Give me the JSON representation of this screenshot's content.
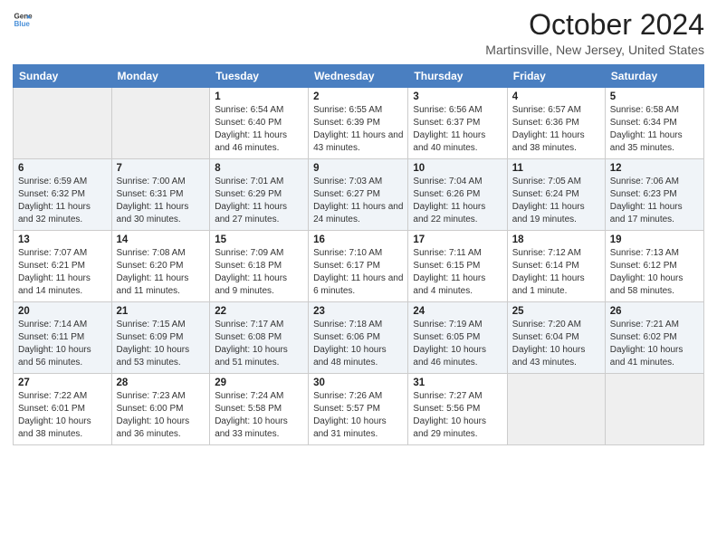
{
  "header": {
    "logo_line1": "General",
    "logo_line2": "Blue",
    "title": "October 2024",
    "subtitle": "Martinsville, New Jersey, United States"
  },
  "weekdays": [
    "Sunday",
    "Monday",
    "Tuesday",
    "Wednesday",
    "Thursday",
    "Friday",
    "Saturday"
  ],
  "weeks": [
    [
      {
        "day": "",
        "empty": true
      },
      {
        "day": "",
        "empty": true
      },
      {
        "day": "1",
        "sunrise": "6:54 AM",
        "sunset": "6:40 PM",
        "daylight": "11 hours and 46 minutes."
      },
      {
        "day": "2",
        "sunrise": "6:55 AM",
        "sunset": "6:39 PM",
        "daylight": "11 hours and 43 minutes."
      },
      {
        "day": "3",
        "sunrise": "6:56 AM",
        "sunset": "6:37 PM",
        "daylight": "11 hours and 40 minutes."
      },
      {
        "day": "4",
        "sunrise": "6:57 AM",
        "sunset": "6:36 PM",
        "daylight": "11 hours and 38 minutes."
      },
      {
        "day": "5",
        "sunrise": "6:58 AM",
        "sunset": "6:34 PM",
        "daylight": "11 hours and 35 minutes."
      }
    ],
    [
      {
        "day": "6",
        "sunrise": "6:59 AM",
        "sunset": "6:32 PM",
        "daylight": "11 hours and 32 minutes."
      },
      {
        "day": "7",
        "sunrise": "7:00 AM",
        "sunset": "6:31 PM",
        "daylight": "11 hours and 30 minutes."
      },
      {
        "day": "8",
        "sunrise": "7:01 AM",
        "sunset": "6:29 PM",
        "daylight": "11 hours and 27 minutes."
      },
      {
        "day": "9",
        "sunrise": "7:03 AM",
        "sunset": "6:27 PM",
        "daylight": "11 hours and 24 minutes."
      },
      {
        "day": "10",
        "sunrise": "7:04 AM",
        "sunset": "6:26 PM",
        "daylight": "11 hours and 22 minutes."
      },
      {
        "day": "11",
        "sunrise": "7:05 AM",
        "sunset": "6:24 PM",
        "daylight": "11 hours and 19 minutes."
      },
      {
        "day": "12",
        "sunrise": "7:06 AM",
        "sunset": "6:23 PM",
        "daylight": "11 hours and 17 minutes."
      }
    ],
    [
      {
        "day": "13",
        "sunrise": "7:07 AM",
        "sunset": "6:21 PM",
        "daylight": "11 hours and 14 minutes."
      },
      {
        "day": "14",
        "sunrise": "7:08 AM",
        "sunset": "6:20 PM",
        "daylight": "11 hours and 11 minutes."
      },
      {
        "day": "15",
        "sunrise": "7:09 AM",
        "sunset": "6:18 PM",
        "daylight": "11 hours and 9 minutes."
      },
      {
        "day": "16",
        "sunrise": "7:10 AM",
        "sunset": "6:17 PM",
        "daylight": "11 hours and 6 minutes."
      },
      {
        "day": "17",
        "sunrise": "7:11 AM",
        "sunset": "6:15 PM",
        "daylight": "11 hours and 4 minutes."
      },
      {
        "day": "18",
        "sunrise": "7:12 AM",
        "sunset": "6:14 PM",
        "daylight": "11 hours and 1 minute."
      },
      {
        "day": "19",
        "sunrise": "7:13 AM",
        "sunset": "6:12 PM",
        "daylight": "10 hours and 58 minutes."
      }
    ],
    [
      {
        "day": "20",
        "sunrise": "7:14 AM",
        "sunset": "6:11 PM",
        "daylight": "10 hours and 56 minutes."
      },
      {
        "day": "21",
        "sunrise": "7:15 AM",
        "sunset": "6:09 PM",
        "daylight": "10 hours and 53 minutes."
      },
      {
        "day": "22",
        "sunrise": "7:17 AM",
        "sunset": "6:08 PM",
        "daylight": "10 hours and 51 minutes."
      },
      {
        "day": "23",
        "sunrise": "7:18 AM",
        "sunset": "6:06 PM",
        "daylight": "10 hours and 48 minutes."
      },
      {
        "day": "24",
        "sunrise": "7:19 AM",
        "sunset": "6:05 PM",
        "daylight": "10 hours and 46 minutes."
      },
      {
        "day": "25",
        "sunrise": "7:20 AM",
        "sunset": "6:04 PM",
        "daylight": "10 hours and 43 minutes."
      },
      {
        "day": "26",
        "sunrise": "7:21 AM",
        "sunset": "6:02 PM",
        "daylight": "10 hours and 41 minutes."
      }
    ],
    [
      {
        "day": "27",
        "sunrise": "7:22 AM",
        "sunset": "6:01 PM",
        "daylight": "10 hours and 38 minutes."
      },
      {
        "day": "28",
        "sunrise": "7:23 AM",
        "sunset": "6:00 PM",
        "daylight": "10 hours and 36 minutes."
      },
      {
        "day": "29",
        "sunrise": "7:24 AM",
        "sunset": "5:58 PM",
        "daylight": "10 hours and 33 minutes."
      },
      {
        "day": "30",
        "sunrise": "7:26 AM",
        "sunset": "5:57 PM",
        "daylight": "10 hours and 31 minutes."
      },
      {
        "day": "31",
        "sunrise": "7:27 AM",
        "sunset": "5:56 PM",
        "daylight": "10 hours and 29 minutes."
      },
      {
        "day": "",
        "empty": true
      },
      {
        "day": "",
        "empty": true
      }
    ]
  ]
}
